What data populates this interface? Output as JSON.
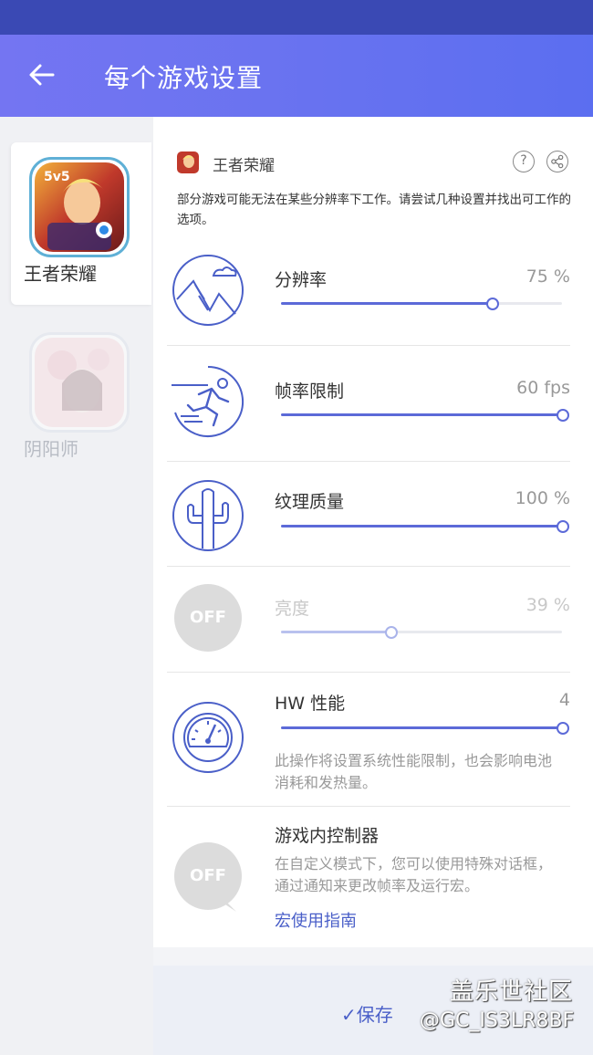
{
  "appbar": {
    "title": "每个游戏设置"
  },
  "sidebar": {
    "games": [
      {
        "name": "王者荣耀",
        "selected": true
      },
      {
        "name": "阴阳师",
        "selected": false
      }
    ]
  },
  "panel": {
    "game_name": "王者荣耀",
    "help_icon": "question-icon",
    "share_icon": "share-icon",
    "description": "部分游戏可能无法在某些分辨率下工作。请尝试几种设置并找出可工作的选项。",
    "rows": [
      {
        "label": "分辨率",
        "value": "75 %",
        "level": 0.75,
        "icon": "mountain-landscape-icon"
      },
      {
        "label": "帧率限制",
        "value": "60 fps",
        "level": 1.0,
        "icon": "runner-icon"
      },
      {
        "label": "纹理质量",
        "value": "100 %",
        "level": 1.0,
        "icon": "cactus-icon"
      },
      {
        "label": "亮度",
        "value": "39 %",
        "level": 0.39,
        "icon": "off-icon",
        "off_text": "OFF"
      },
      {
        "label": "HW 性能",
        "value": "4",
        "level": 1.0,
        "icon": "speedometer-icon",
        "note": "此操作将设置系统性能限制，也会影响电池消耗和发热量。"
      }
    ],
    "controller": {
      "label": "游戏内控制器",
      "off_text": "OFF",
      "note": "在自定义模式下，您可以使用特殊对话框，通过通知来更改帧率及运行宏。",
      "link": "宏使用指南"
    }
  },
  "bottom": {
    "save": "✓保存",
    "watermark_title": "盖乐世社区",
    "watermark_user": "@GC_IS3LR8BF"
  },
  "colors": {
    "accent": "#5c6ad8",
    "appbar": "#6a73f0",
    "statusbar": "#3a49b4",
    "link": "#4a5fc8"
  }
}
